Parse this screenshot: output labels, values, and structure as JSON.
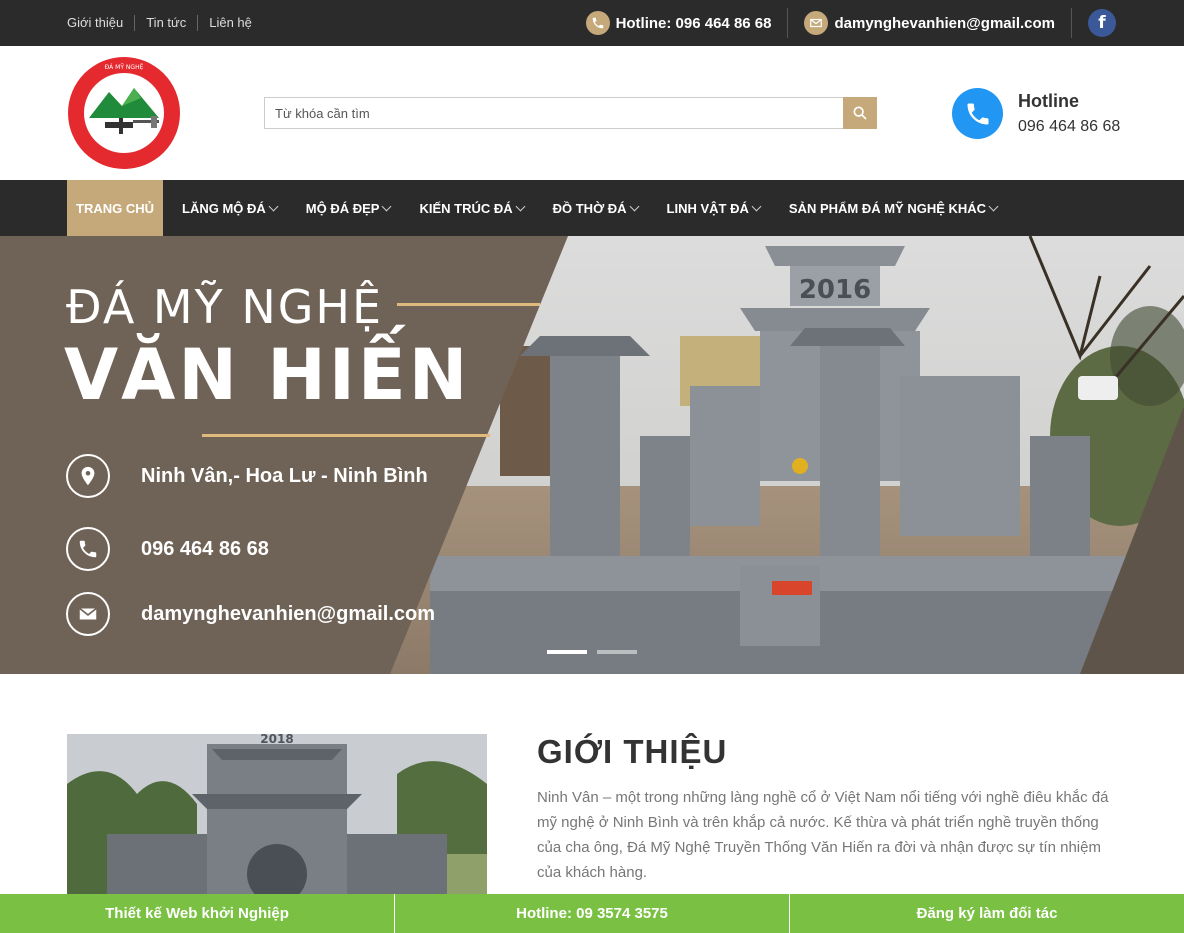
{
  "topbar": {
    "links": [
      "Giới thiệu",
      "Tin tức",
      "Liên hệ"
    ],
    "hotline": "Hotline: 096 464 86 68",
    "email": "damynghevanhien@gmail.com",
    "facebook": "f"
  },
  "header": {
    "logo_text": "ĐÁ MỸ NGHỆ TRUYỀN THỐNG VĂN HIẾN - LÀNG ĐÁ NINH VÂN - HOA LƯ - NINH BÌNH",
    "search_placeholder": "Từ khóa cần tìm",
    "hotline_label": "Hotline",
    "hotline_number": "096 464 86 68"
  },
  "nav": {
    "items": [
      {
        "label": "TRANG CHỦ",
        "active": true
      },
      {
        "label": "LĂNG MỘ ĐÁ"
      },
      {
        "label": "MỘ ĐÁ ĐẸP"
      },
      {
        "label": "KIẾN TRÚC ĐÁ"
      },
      {
        "label": "ĐỒ THỜ ĐÁ"
      },
      {
        "label": "LINH VẬT ĐÁ"
      },
      {
        "label": "SẢN PHẨM ĐÁ MỸ NGHỆ KHÁC"
      }
    ]
  },
  "hero": {
    "line1": "ĐÁ MỸ NGHỆ",
    "line2": "VĂN HIẾN",
    "address": "Ninh Vân,- Hoa Lư - Ninh Bình",
    "phone": "096 464 86 68",
    "email": "damynghevanhien@gmail.com",
    "photo_year": "2016",
    "slides": 2,
    "active_slide": 1
  },
  "intro": {
    "title": "GIỚI THIỆU",
    "text": "Ninh Vân – một trong những làng nghề cổ ở Việt Nam nổi tiếng với nghề điêu khắc đá mỹ nghệ ở Ninh Bình và trên khắp cả nước. Kế thừa và phát triển nghề truyền thống của cha ông, Đá Mỹ Nghệ Truyền Thống Văn Hiến ra đời và nhận được sự tín nhiệm của khách hàng.",
    "photo_year": "2018"
  },
  "bottombar": {
    "items": [
      "Thiết kế Web khởi Nghiệp",
      "Hotline: 09 3574 3575",
      "Đăng ký làm đối tác"
    ]
  },
  "colors": {
    "dark": "#2b2b2b",
    "gold": "#c5a97a",
    "hero_brown": "#6f6256",
    "blue": "#2196f3",
    "green": "#7ac143",
    "facebook": "#3b5998"
  }
}
